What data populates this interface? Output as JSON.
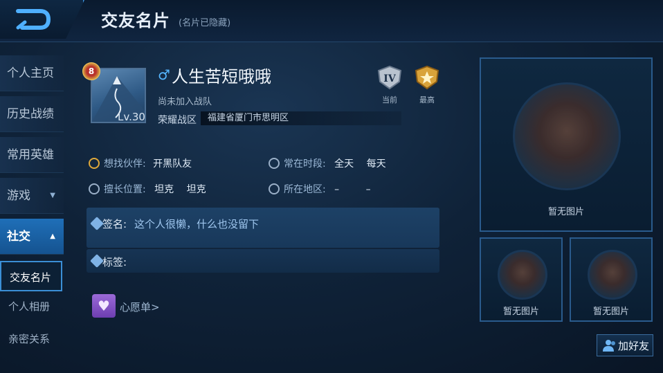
{
  "header": {
    "title": "交友名片",
    "subtitle": "(名片已隐藏)"
  },
  "sidebar": {
    "items": [
      {
        "label": "个人主页"
      },
      {
        "label": "历史战绩"
      },
      {
        "label": "常用英雄"
      },
      {
        "label": "游戏"
      },
      {
        "label": "社交"
      }
    ],
    "sub_items": [
      {
        "label": "交友名片"
      },
      {
        "label": "个人相册"
      },
      {
        "label": "亲密关系"
      }
    ]
  },
  "profile": {
    "level_badge": "8",
    "level": "Lv.30",
    "gender_symbol": "♂",
    "name": "人生苦短哦哦",
    "team_status": "尚未加入战队",
    "zone_label": "荣耀战区",
    "zone_value": "福建省厦门市思明区",
    "rank_current_label": "当前",
    "rank_current_numeral": "IV",
    "rank_best_label": "最高"
  },
  "info": {
    "partner_label": "想找伙伴:",
    "partner_value": "开黑队友",
    "time_label": "常在时段:",
    "time_value1": "全天",
    "time_value2": "每天",
    "position_label": "擅长位置:",
    "position_value1": "坦克",
    "position_value2": "坦克",
    "region_label": "所在地区:",
    "region_value1": "–",
    "region_value2": "–"
  },
  "signature": {
    "label": "签名:",
    "value": "这个人很懒，什么也没留下"
  },
  "tags": {
    "label": "标签:"
  },
  "wishlist": {
    "label": "心愿单>"
  },
  "photos": {
    "main_placeholder": "暂无图片",
    "small1_placeholder": "暂无图片",
    "small2_placeholder": "暂无图片"
  },
  "actions": {
    "add_friend": "加好友"
  },
  "colors": {
    "accent": "#3b8fd6",
    "active_tab": "#1f6fb8",
    "gender": "#55b6ff"
  }
}
